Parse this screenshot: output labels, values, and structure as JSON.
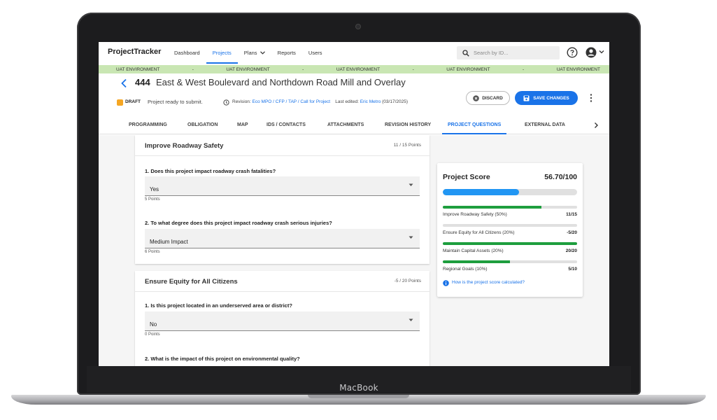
{
  "app": {
    "logo": "ProjectTracker",
    "nav": [
      "Dashboard",
      "Projects",
      "Plans",
      "Reports",
      "Users"
    ],
    "nav_active": "Projects",
    "search_placeholder": "Search by ID..."
  },
  "env_banner": [
    "UAT ENVIRONMENT",
    "-",
    "UAT ENVIRONMENT",
    "-",
    "UAT ENVIRONMENT",
    "-",
    "UAT ENVIRONMENT",
    "-",
    "UAT ENVIRONMENT"
  ],
  "project": {
    "number": "444",
    "name": "East & West Boulevard and Northdown Road Mill and Overlay",
    "status_badge": "DRAFT",
    "status_text": "Project ready to submit.",
    "revision_label": "Revision:",
    "revision_link": "Eco MPO / CFP / TAP / Call for Project",
    "last_edited_label": "Last edited:",
    "last_edited_by": "Eric Metro",
    "last_edited_date": "(03/17/2025)"
  },
  "actions": {
    "discard": "DISCARD",
    "save": "SAVE CHANGES"
  },
  "tabs": [
    "PROGRAMMING",
    "OBLIGATION",
    "MAP",
    "IDS / CONTACTS",
    "ATTACHMENTS",
    "REVISION HISTORY",
    "PROJECT QUESTIONS",
    "EXTERNAL DATA"
  ],
  "tab_active": "PROJECT QUESTIONS",
  "sections": [
    {
      "title": "Improve Roadway Safety",
      "points": "11 / 15 Points",
      "questions": [
        {
          "text": "1. Does this project impact roadway crash fatalities?",
          "answer": "Yes",
          "points": "5 Points"
        },
        {
          "text": "2. To what degree does this project impact roadway crash serious injuries?",
          "answer": "Medium Impact",
          "points": "6 Points"
        }
      ]
    },
    {
      "title": "Ensure Equity for All Citizens",
      "points": "-5 / 20 Points",
      "questions": [
        {
          "text": "1. Is this project located in an underserved area or district?",
          "answer": "No",
          "points": "0 Points"
        },
        {
          "text": "2. What is the impact of this project on environmental quality?",
          "answer": "",
          "points": ""
        }
      ]
    }
  ],
  "score": {
    "title": "Project Score",
    "value": "56.70/100",
    "fraction": 0.567,
    "items": [
      {
        "label": "Improve Roadway Safety (50%)",
        "score": "11/15",
        "fraction": 0.7333
      },
      {
        "label": "Ensure Equity for All Citizens (20%)",
        "score": "-5/20",
        "fraction": 0.0
      },
      {
        "label": "Maintain Capital Assets (20%)",
        "score": "20/20",
        "fraction": 1.0
      },
      {
        "label": "Regional Goals (10%)",
        "score": "5/10",
        "fraction": 0.5
      }
    ],
    "help_link": "How is the project score calculated?"
  },
  "device": {
    "brand": "MacBook"
  },
  "colors": {
    "accent": "#1a73e8",
    "progress": "#2196f3",
    "sub_progress": "#1e9e3e",
    "draft": "#f5a623",
    "env_banner": "#c9e6b3"
  }
}
